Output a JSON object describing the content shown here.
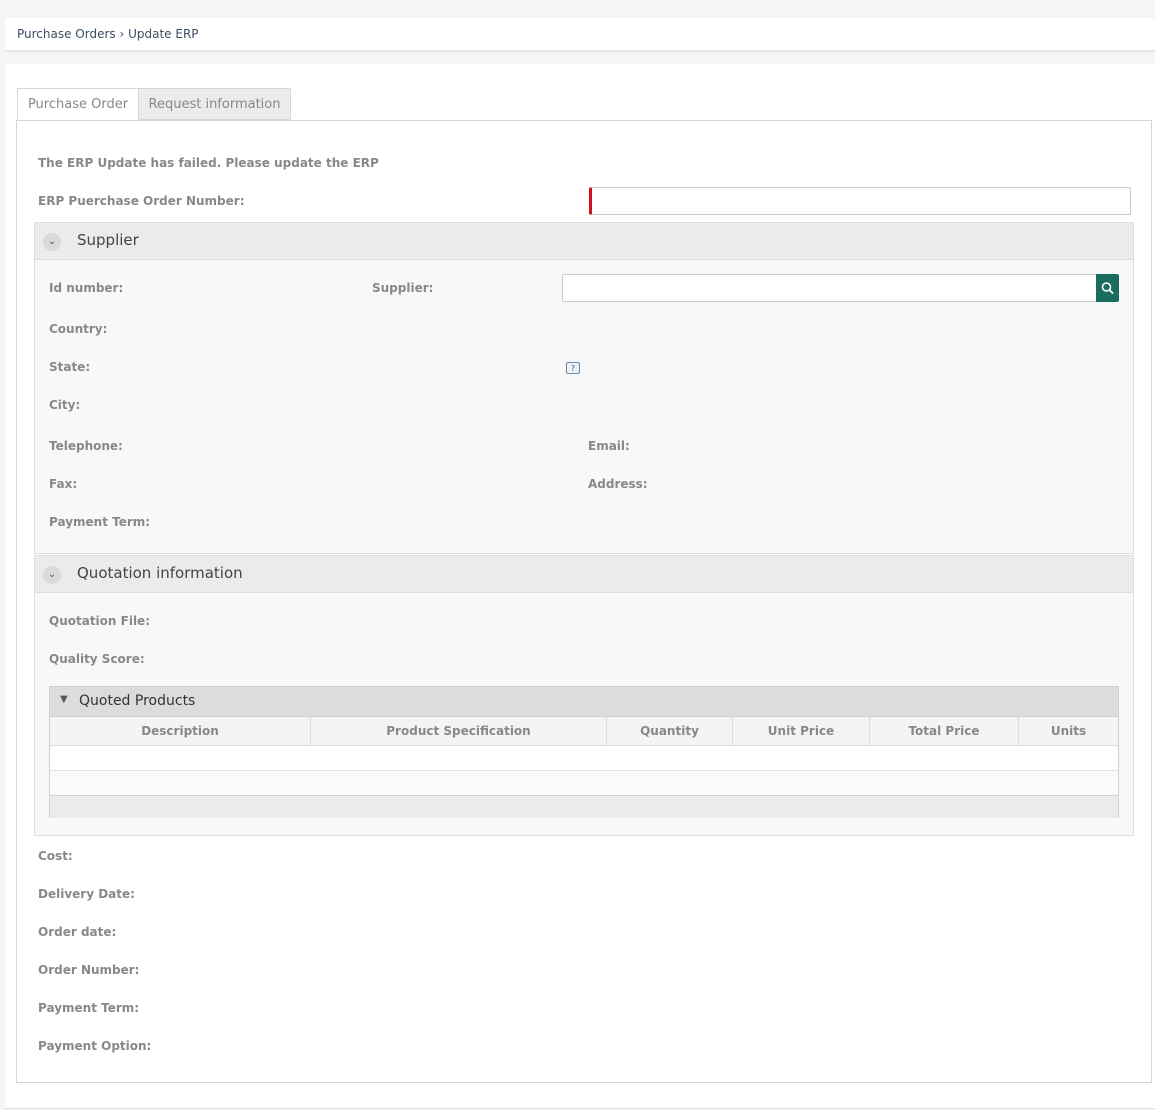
{
  "breadcrumb": {
    "path": "Purchase Orders › Update ERP"
  },
  "tabs": [
    {
      "label": "Purchase Order"
    },
    {
      "label": "Request information"
    }
  ],
  "message": "The ERP Update has failed. Please update the ERP",
  "erp_field": {
    "label": "ERP Puerchase Order Number:",
    "value": ""
  },
  "supplier_section": {
    "title": "Supplier",
    "id_label": "Id number:",
    "supplier_label": "Supplier:",
    "supplier_value": "",
    "country_label": "Country:",
    "state_label": "State:",
    "help_glyph": "?",
    "city_label": "City:",
    "telephone_label": "Telephone:",
    "email_label": "Email:",
    "fax_label": "Fax:",
    "address_label": "Address:",
    "payment_term_label": "Payment Term:"
  },
  "quotation_section": {
    "title": "Quotation information",
    "file_label": "Quotation File:",
    "score_label": "Quality Score:"
  },
  "quoted_products": {
    "title": "Quoted Products",
    "columns": [
      "Description",
      "Product Specification",
      "Quantity",
      "Unit Price",
      "Total Price",
      "Units"
    ],
    "rows": []
  },
  "bottom_fields": {
    "cost": "Cost:",
    "delivery_date": "Delivery Date:",
    "order_date": "Order date:",
    "order_number": "Order Number:",
    "payment_term": "Payment Term:",
    "payment_option": "Payment Option:"
  },
  "icons": {
    "search": "search-icon",
    "chevron": "chevron-down-icon",
    "help": "help-icon"
  },
  "colors": {
    "accent": "#1a6b60",
    "error": "#d0101b"
  }
}
